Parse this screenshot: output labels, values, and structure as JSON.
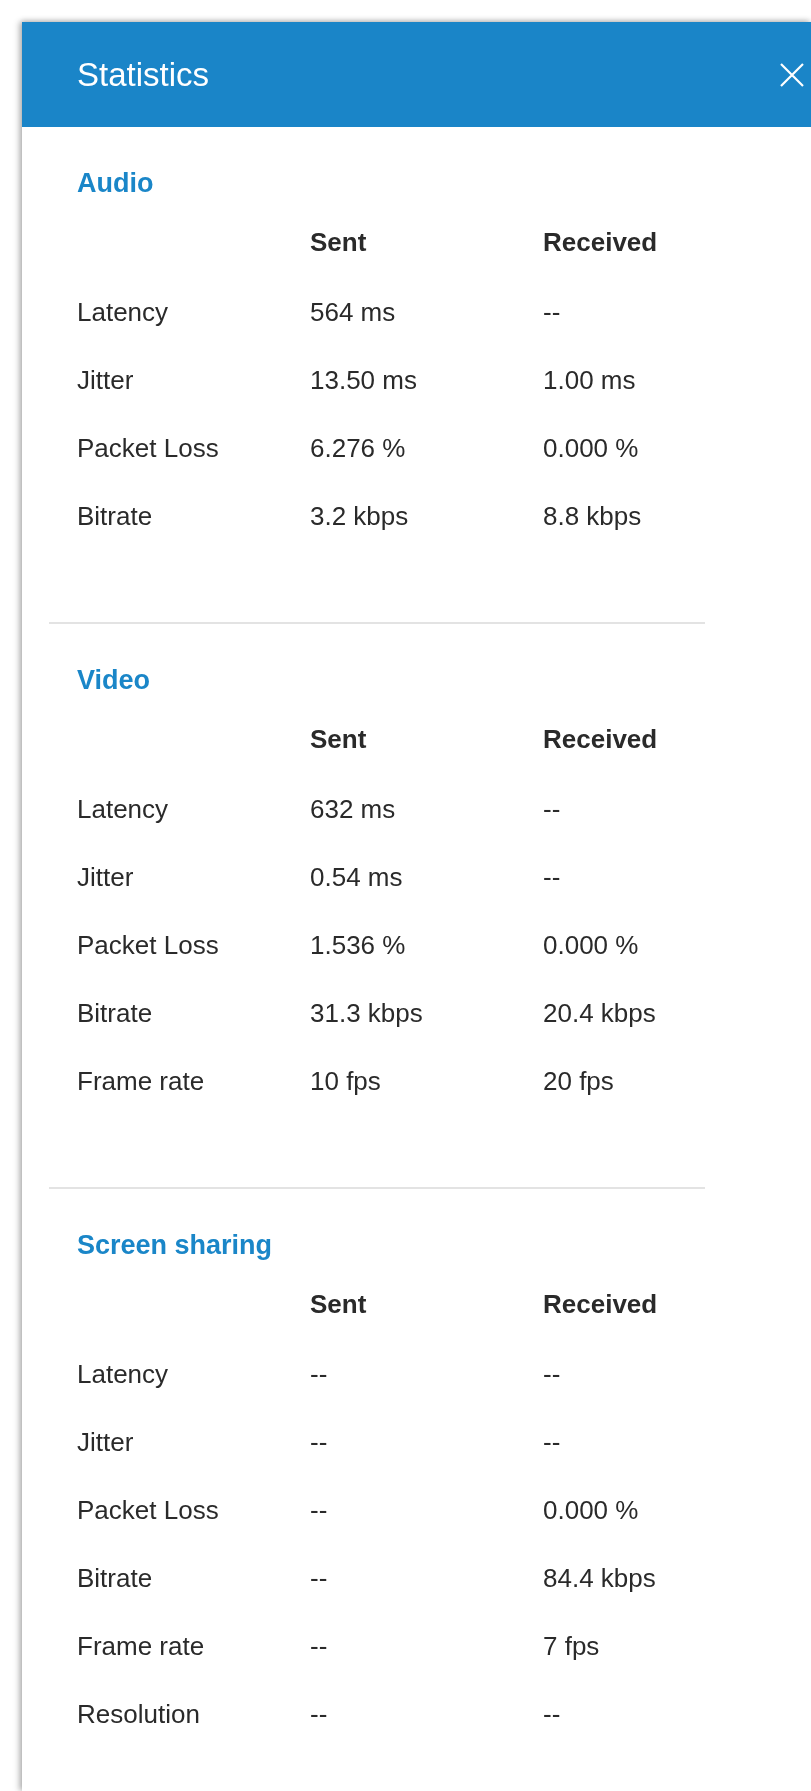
{
  "window": {
    "title": "Statistics"
  },
  "sections": [
    {
      "title": "Audio",
      "columns": [
        "Sent",
        "Received"
      ],
      "rows": [
        {
          "label": "Latency",
          "values": [
            "564 ms",
            "--"
          ]
        },
        {
          "label": "Jitter",
          "values": [
            "13.50 ms",
            "1.00 ms"
          ]
        },
        {
          "label": "Packet Loss",
          "values": [
            "6.276 %",
            "0.000 %"
          ]
        },
        {
          "label": "Bitrate",
          "values": [
            "3.2 kbps",
            "8.8 kbps"
          ]
        }
      ]
    },
    {
      "title": "Video",
      "columns": [
        "Sent",
        "Received"
      ],
      "rows": [
        {
          "label": "Latency",
          "values": [
            "632 ms",
            "--"
          ]
        },
        {
          "label": "Jitter",
          "values": [
            "0.54 ms",
            "--"
          ]
        },
        {
          "label": "Packet Loss",
          "values": [
            "1.536 %",
            "0.000 %"
          ]
        },
        {
          "label": "Bitrate",
          "values": [
            "31.3 kbps",
            "20.4 kbps"
          ]
        },
        {
          "label": "Frame rate",
          "values": [
            "10 fps",
            "20 fps"
          ]
        }
      ]
    },
    {
      "title": "Screen sharing",
      "columns": [
        "Sent",
        "Received"
      ],
      "rows": [
        {
          "label": "Latency",
          "values": [
            "--",
            "--"
          ]
        },
        {
          "label": "Jitter",
          "values": [
            "--",
            "--"
          ]
        },
        {
          "label": "Packet Loss",
          "values": [
            "--",
            "0.000 %"
          ]
        },
        {
          "label": "Bitrate",
          "values": [
            "--",
            "84.4 kbps"
          ]
        },
        {
          "label": "Frame rate",
          "values": [
            "--",
            "7 fps"
          ]
        },
        {
          "label": "Resolution",
          "values": [
            "--",
            "--"
          ]
        }
      ]
    }
  ]
}
